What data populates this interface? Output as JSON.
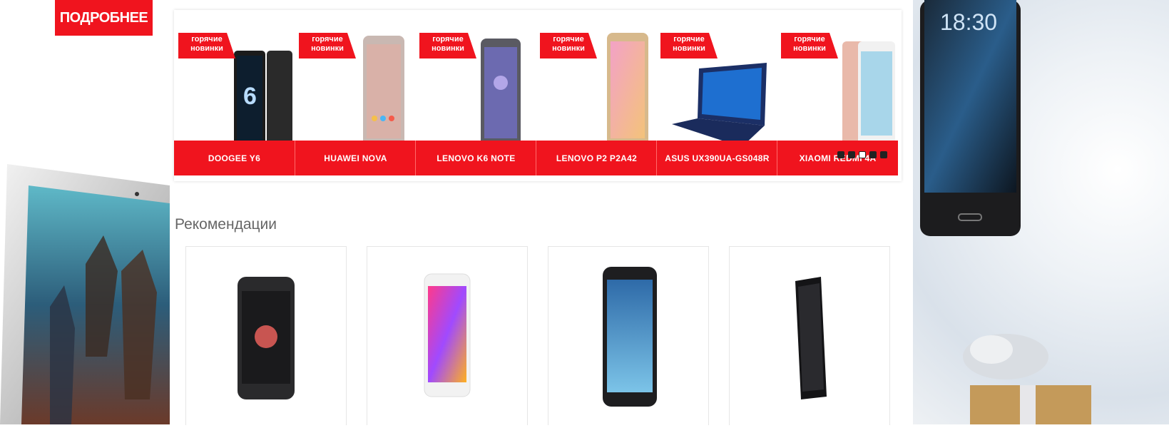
{
  "banner_left": {
    "button_label": "ПОДРОБНЕЕ"
  },
  "right_phone": {
    "clock": "18:30"
  },
  "hot_slider": {
    "tag_line1": "горячие",
    "tag_line2": "новинки",
    "items": [
      {
        "name": "DOOGEE Y6"
      },
      {
        "name": "HUAWEI NOVA"
      },
      {
        "name": "LENOVO K6 NOTE"
      },
      {
        "name": "LENOVO P2 P2A42"
      },
      {
        "name": "ASUS UX390UA-GS048R"
      },
      {
        "name": "XIAOMI REDMI 4A"
      }
    ]
  },
  "recommendations": {
    "title": "Рекомендации"
  },
  "colors": {
    "accent": "#f0141e"
  }
}
